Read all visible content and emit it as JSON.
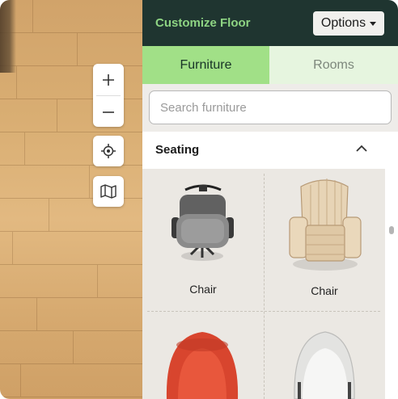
{
  "map": {
    "zoom_in_icon": "plus-icon",
    "zoom_out_icon": "minus-icon",
    "locate_icon": "crosshair-icon",
    "map_icon": "folded-map-icon"
  },
  "panel": {
    "title": "Customize Floor",
    "options_label": "Options",
    "tabs": [
      {
        "label": "Furniture",
        "active": true
      },
      {
        "label": "Rooms",
        "active": false
      }
    ],
    "search": {
      "placeholder": "Search furniture",
      "value": ""
    },
    "section": {
      "label": "Seating",
      "expanded": true
    },
    "items": [
      {
        "label": "Chair",
        "image": "gray-office-chair"
      },
      {
        "label": "Chair",
        "image": "wooden-adirondack-chair"
      },
      {
        "label": "",
        "image": "red-tub-chair"
      },
      {
        "label": "",
        "image": "white-shell-chair"
      }
    ]
  },
  "colors": {
    "header_bg": "#1f3530",
    "title_green": "#8ed483",
    "tab_active": "#a1e087",
    "tab_inactive": "#e6f5df",
    "grid_bg": "#ebe8e3"
  }
}
